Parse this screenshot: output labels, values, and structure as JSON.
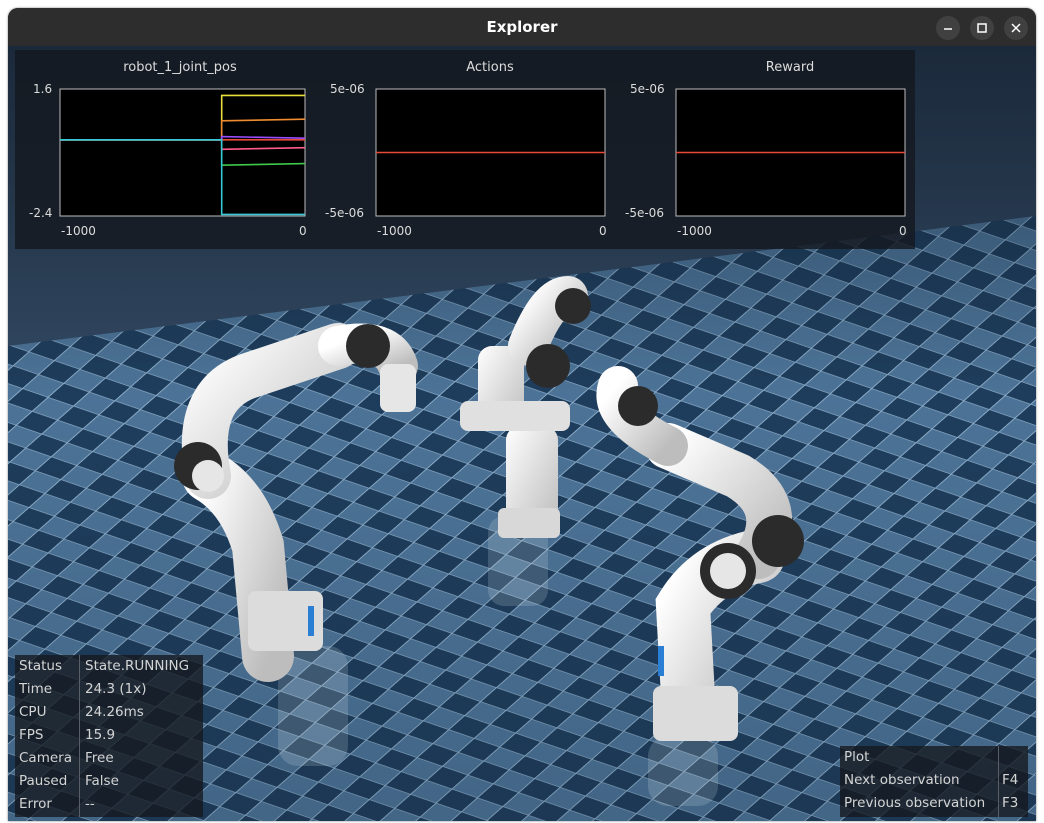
{
  "window": {
    "title": "Explorer"
  },
  "plots": [
    {
      "title": "robot_1_joint_pos",
      "y_max": "1.6",
      "y_min": "-2.4",
      "x_min": "-1000",
      "x_max": "0"
    },
    {
      "title": "Actions",
      "y_max": "5e-06",
      "y_min": "-5e-06",
      "x_min": "-1000",
      "x_max": "0"
    },
    {
      "title": "Reward",
      "y_max": "5e-06",
      "y_min": "-5e-06",
      "x_min": "-1000",
      "x_max": "0"
    }
  ],
  "chart_data": [
    {
      "type": "line",
      "title": "robot_1_joint_pos",
      "xlim": [
        -1000,
        0
      ],
      "ylim": [
        -2.4,
        1.6
      ],
      "series": [
        {
          "color": "#e8e03a",
          "x": [
            -1000,
            -340,
            -340,
            0
          ],
          "values": [
            0,
            0,
            1.4,
            1.4
          ]
        },
        {
          "color": "#f08c30",
          "x": [
            -1000,
            -340,
            -340,
            0
          ],
          "values": [
            0,
            0,
            0.6,
            0.65
          ]
        },
        {
          "color": "#9b4dff",
          "x": [
            -1000,
            -340,
            -340,
            0
          ],
          "values": [
            0,
            0,
            0.1,
            0.05
          ]
        },
        {
          "color": "#e84a3a",
          "x": [
            -1000,
            0
          ],
          "values": [
            0,
            0
          ]
        },
        {
          "color": "#ff5a8a",
          "x": [
            -1000,
            -340,
            -340,
            0
          ],
          "values": [
            0,
            0,
            -0.3,
            -0.25
          ]
        },
        {
          "color": "#3ec94a",
          "x": [
            -1000,
            -340,
            -340,
            0
          ],
          "values": [
            0,
            0,
            -0.8,
            -0.75
          ]
        },
        {
          "color": "#35c8d8",
          "x": [
            -1000,
            -340,
            -340,
            0
          ],
          "values": [
            0,
            0,
            -2.35,
            -2.35
          ]
        }
      ]
    },
    {
      "type": "line",
      "title": "Actions",
      "xlim": [
        -1000,
        0
      ],
      "ylim": [
        -5e-06,
        5e-06
      ],
      "series": [
        {
          "color": "#e84a3a",
          "x": [
            -1000,
            0
          ],
          "values": [
            0,
            0
          ]
        }
      ]
    },
    {
      "type": "line",
      "title": "Reward",
      "xlim": [
        -1000,
        0
      ],
      "ylim": [
        -5e-06,
        5e-06
      ],
      "series": [
        {
          "color": "#e84a3a",
          "x": [
            -1000,
            0
          ],
          "values": [
            0,
            0
          ]
        }
      ]
    }
  ],
  "status": {
    "rows": [
      {
        "key": "Status",
        "value": "State.RUNNING"
      },
      {
        "key": "Time",
        "value": "24.3 (1x)"
      },
      {
        "key": "CPU",
        "value": "24.26ms"
      },
      {
        "key": "FPS",
        "value": "15.9"
      },
      {
        "key": "Camera",
        "value": "Free"
      },
      {
        "key": "Paused",
        "value": "False"
      },
      {
        "key": "Error",
        "value": "--"
      }
    ]
  },
  "shortcuts": {
    "rows": [
      {
        "label": "Plot",
        "key": ""
      },
      {
        "label": "Next observation",
        "key": "F4"
      },
      {
        "label": "Previous observation",
        "key": "F3"
      }
    ]
  },
  "colors": {
    "floor_dark": "#1e3d5c",
    "floor_light": "#4c7397",
    "robot_body": "#e6e6e6",
    "robot_joint": "#2b2b2b"
  }
}
